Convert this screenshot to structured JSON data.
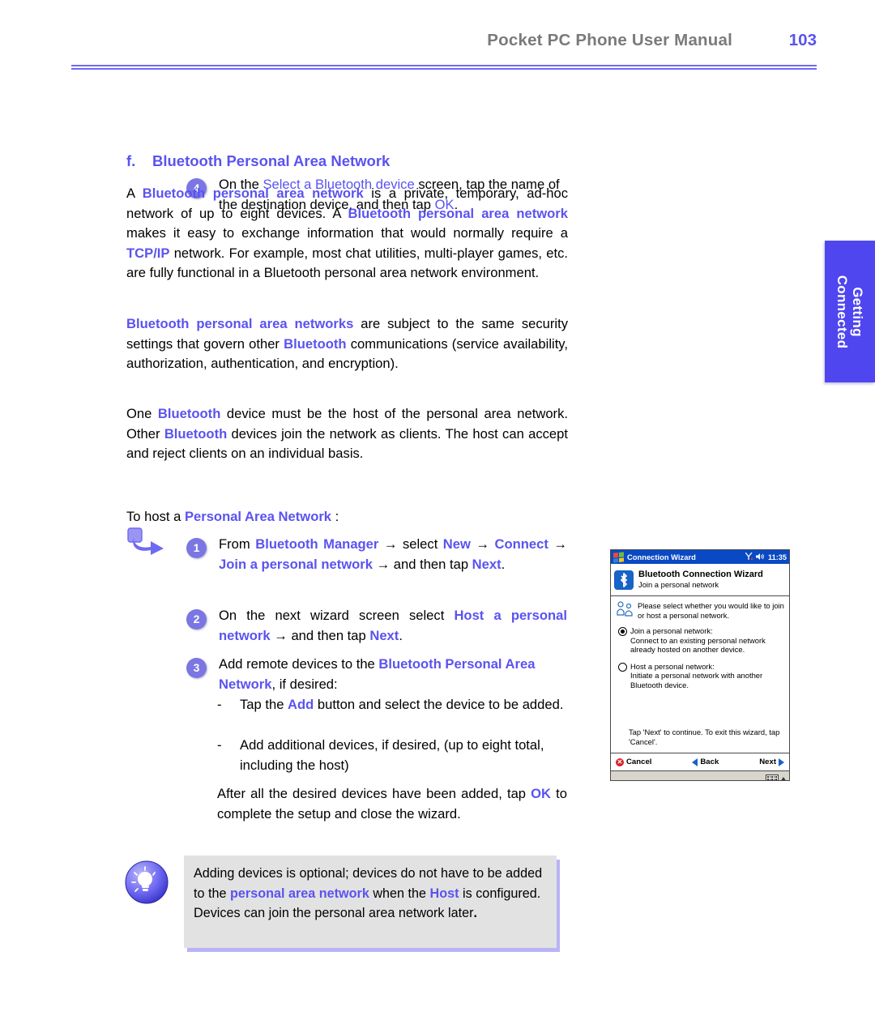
{
  "header": {
    "title": "Pocket PC Phone User Manual",
    "page_number": "103"
  },
  "side_tab": {
    "line1": "Getting",
    "line2": "Connected"
  },
  "step4": {
    "number": "4",
    "text_pre": "On the ",
    "kw1": "Select a Bluetooth device",
    "text_mid": " screen, tap the name of the destination device, and then tap ",
    "kw2": "OK",
    "text_end": "."
  },
  "section": {
    "letter": "f.",
    "title": "Bluetooth Personal Area Network"
  },
  "paragraphs": {
    "p1": {
      "s1": "A ",
      "k1": "Bluetooth personal area network",
      "s2": " is a private, temporary, ad-hoc network of up to eight devices. A ",
      "k2": "Bluetooth personal area network",
      "s3": " makes it easy to exchange information that would normally require a ",
      "k3": "TCP/IP",
      "s4": " network. For example, most chat utilities, multi-player games, etc. are fully functional in a Bluetooth personal area network environment."
    },
    "p2": {
      "k1": "Bluetooth personal area networks",
      "s1": " are subject to the same security settings that govern other ",
      "k2": "Bluetooth",
      "s2": " communications (service availability, authorization, authentication, and encryption)."
    },
    "p3": {
      "s1": "One ",
      "k1": "Bluetooth",
      "s2": " device must be the host of the personal area network. Other ",
      "k2": "Bluetooth",
      "s3": " devices join the network as clients. The host can accept and reject clients on an individual basis."
    }
  },
  "to_host": {
    "s1": "To host a ",
    "k1": "Personal Area Network",
    "s2": " :"
  },
  "steps": {
    "step1": {
      "number": "1",
      "s1": "From ",
      "k1": "Bluetooth Manager",
      "a1": " → ",
      "s2": "select ",
      "k2": "New",
      "a2": " → ",
      "k3": "Connect",
      "a3": " → ",
      "k4": "Join a personal network",
      "a4": " → ",
      "s3": "and then tap ",
      "k5": "Next",
      "s4": "."
    },
    "step2": {
      "number": "2",
      "s1": "On the next wizard screen select ",
      "k1": "Host a personal network",
      "a1": " → ",
      "s2": "and then tap ",
      "k2": "Next",
      "s3": "."
    },
    "step3": {
      "number": "3",
      "s1": "Add remote devices to the ",
      "k1": "Bluetooth Personal Area Network",
      "s2": ", if desired:"
    },
    "bullet1": {
      "dash": "-",
      "s1": "Tap the ",
      "k1": "Add",
      "s2": " button and select the device to be added."
    },
    "bullet2": {
      "dash": "-",
      "s1": "Add additional devices, if desired, (up to eight total, including the host)"
    },
    "closing": {
      "s1": "After all the desired devices have been added, tap ",
      "k1": "OK",
      "s2": " to complete the setup and close the wizard."
    }
  },
  "note": {
    "s1": "Adding devices is optional; devices do not have to be added to the ",
    "k1": "personal area network",
    "s2": " when the ",
    "k2": "Host",
    "s3": " is configured. Devices can join the personal area network later",
    "s4": "."
  },
  "pda": {
    "titlebar": {
      "title": "Connection Wizard",
      "signal": "Ті",
      "time": "11:35"
    },
    "header": {
      "title": "Bluetooth Connection Wizard",
      "subtitle": "Join a personal network"
    },
    "intro": "Please select whether you would like to join or host a personal network.",
    "options": [
      {
        "title": "Join a personal network:",
        "desc": "Connect to an existing personal network already hosted on another device.",
        "selected": true
      },
      {
        "title": "Host a personal network:",
        "desc": "Initiate a personal network with another Bluetooth device.",
        "selected": false
      }
    ],
    "tip": "Tap 'Next' to continue. To exit this wizard, tap 'Cancel'.",
    "buttons": {
      "cancel": "Cancel",
      "back": "Back",
      "next": "Next"
    }
  },
  "colors": {
    "accent_blue": "#5a53f0",
    "header_gray": "#7a7a7a",
    "tab_blue": "#4f46f0",
    "note_bg": "#e2e2e2"
  }
}
